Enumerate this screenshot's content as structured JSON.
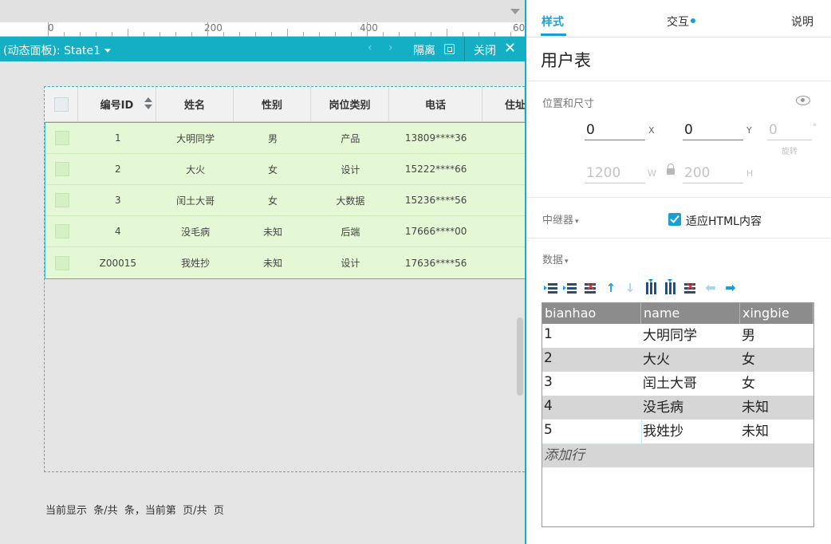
{
  "ruler": {
    "labels": [
      "0",
      "200",
      "400",
      "60"
    ]
  },
  "panel_bar": {
    "title": "(动态面板): State1",
    "prev_icon": "‹",
    "next_icon": "›",
    "isolate_label": "隔离",
    "close_label": "关闭",
    "close_icon": "✕"
  },
  "grid": {
    "headers": [
      "",
      "编号ID",
      "姓名",
      "性别",
      "岗位类别",
      "电话",
      "住址"
    ],
    "rows": [
      [
        "1",
        "大明同学",
        "男",
        "产品",
        "13809****36"
      ],
      [
        "2",
        "大火",
        "女",
        "设计",
        "15222****66"
      ],
      [
        "3",
        "闰土大哥",
        "女",
        "大数据",
        "15236****56"
      ],
      [
        "4",
        "没毛病",
        "未知",
        "后端",
        "17666****00"
      ],
      [
        "Z00015",
        "我姓抄",
        "未知",
        "设计",
        "17636****56"
      ]
    ]
  },
  "pager_text": "当前显示  条/共  条，当前第  页/共  页",
  "inspector": {
    "tabs": [
      "样式",
      "交互",
      "说明"
    ],
    "widget_name": "用户表",
    "position_section": {
      "title": "位置和尺寸",
      "x": "0",
      "y": "0",
      "rotation": "0",
      "w": "1200",
      "h": "200",
      "x_tag": "X",
      "y_tag": "Y",
      "rot_tag": "°",
      "w_tag": "W",
      "h_tag": "H",
      "rotate_label": "旋转"
    },
    "repeater_section": {
      "title": "中继器",
      "fit_html_label": "适应HTML内容",
      "fit_html_checked": true
    },
    "data_section": {
      "title": "数据",
      "columns": [
        "bianhao",
        "name",
        "xingbie"
      ],
      "rows": [
        [
          "1",
          "大明同学",
          "男"
        ],
        [
          "2",
          "大火",
          "女"
        ],
        [
          "3",
          "闰土大哥",
          "女"
        ],
        [
          "4",
          "没毛病",
          "未知"
        ],
        [
          "5",
          "我姓抄",
          "未知"
        ]
      ],
      "add_row_label": "添加行"
    }
  },
  "colors": {
    "accent": "#14afc4",
    "tab_active": "#1a9ed6",
    "row_highlight": "#e4f8d5"
  }
}
